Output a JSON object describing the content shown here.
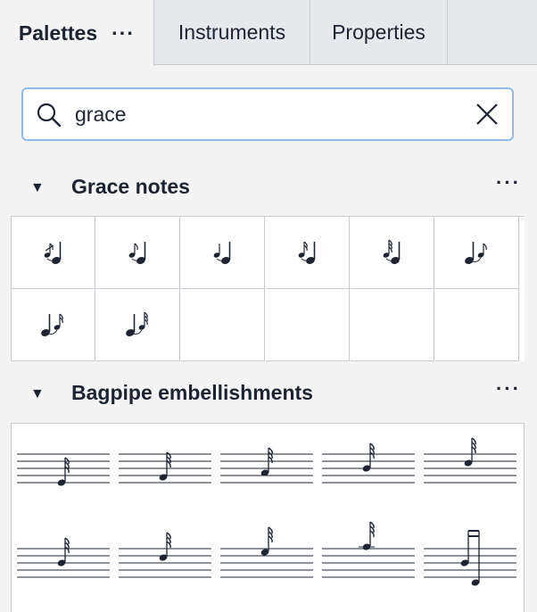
{
  "tabs": [
    {
      "label": "Palettes",
      "active": true,
      "menu": "···"
    },
    {
      "label": "Instruments",
      "active": false
    },
    {
      "label": "Properties",
      "active": false
    }
  ],
  "search": {
    "value": "grace",
    "placeholder": "Search"
  },
  "sections": {
    "grace": {
      "title": "Grace notes",
      "more": "···",
      "items": [
        "acciaccatura",
        "appoggiatura",
        "grace-note-quarter",
        "grace-note-16th",
        "grace-note-32nd",
        "grace-note-eighth-after",
        "grace-note-16th-after",
        "grace-note-32nd-after"
      ]
    },
    "bagpipe": {
      "title": "Bagpipe embellishments",
      "more": "···",
      "items": [
        "bagpipe-single-grace-low-g",
        "bagpipe-single-grace-low-a",
        "bagpipe-single-grace-b",
        "bagpipe-single-grace-c",
        "bagpipe-single-grace-d",
        "bagpipe-single-grace-e",
        "bagpipe-single-grace-f",
        "bagpipe-single-grace-high-g",
        "bagpipe-single-grace-high-a",
        "bagpipe-double-grace"
      ]
    }
  },
  "colors": {
    "accent": "#8fb8e2",
    "text": "#1c2433",
    "border": "#c7ccd2"
  }
}
